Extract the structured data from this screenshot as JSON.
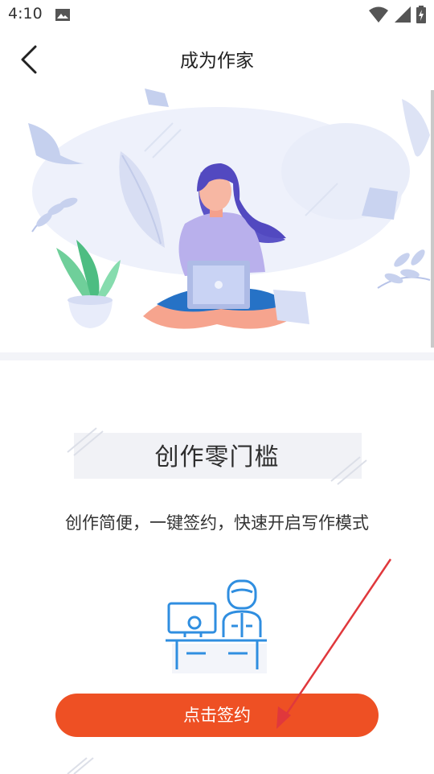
{
  "status_bar": {
    "time": "4:10"
  },
  "header": {
    "title": "成为作家"
  },
  "section": {
    "title": "创作零门槛",
    "description": "创作简便，一键签约，快速开启写作模式"
  },
  "actions": {
    "sign_label": "点击签约"
  },
  "colors": {
    "accent": "#ee5024",
    "illustration_blue": "#2f8ee0"
  }
}
